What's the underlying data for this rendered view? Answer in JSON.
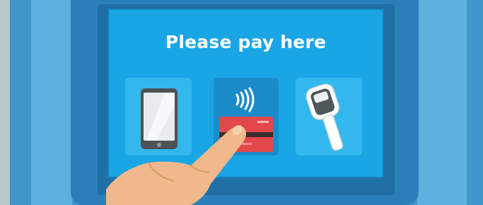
{
  "screen": {
    "title": "Please pay here"
  },
  "payment_options": [
    {
      "id": "phone",
      "icon": "smartphone-icon"
    },
    {
      "id": "card",
      "icon": "contactless-card-icon"
    },
    {
      "id": "scanner",
      "icon": "barcode-scanner-icon"
    }
  ],
  "colors": {
    "screen": "#1aa6e5",
    "tile": "#32b8ec",
    "tile_selected": "#1c8cc8",
    "card": "#e2474b",
    "kiosk": "#3f97cc"
  }
}
